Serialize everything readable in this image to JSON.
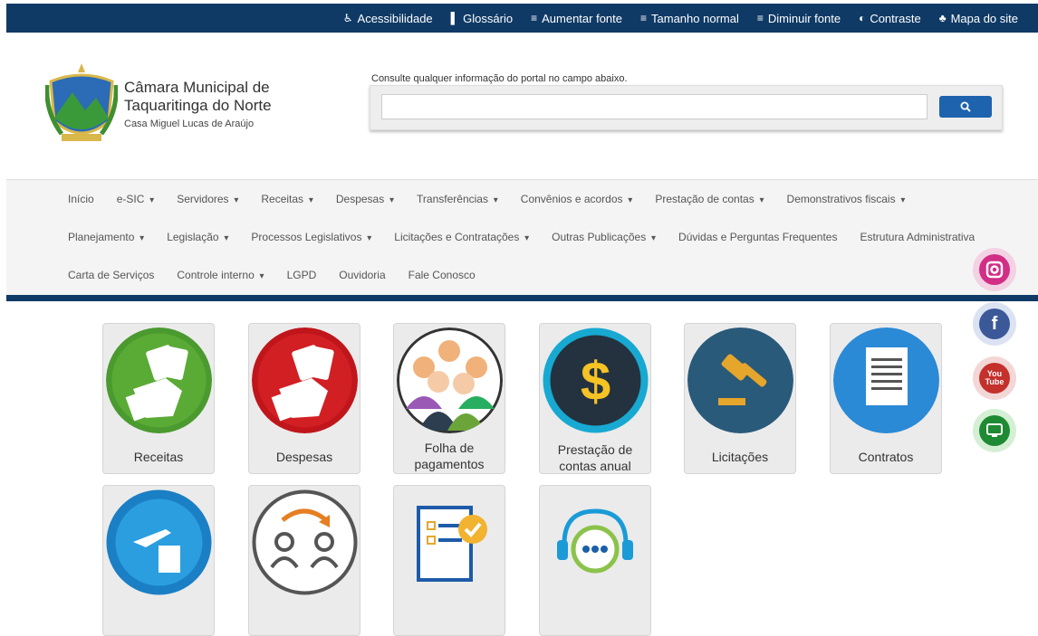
{
  "topbar": {
    "items": [
      {
        "label": "Acessibilidade",
        "icon": "accessibility-icon"
      },
      {
        "label": "Glossário",
        "icon": "book-icon"
      },
      {
        "label": "Aumentar fonte",
        "icon": "font-increase-icon"
      },
      {
        "label": "Tamanho normal",
        "icon": "font-normal-icon"
      },
      {
        "label": "Diminuir fonte",
        "icon": "font-decrease-icon"
      },
      {
        "label": "Contraste",
        "icon": "contrast-icon"
      },
      {
        "label": "Mapa do site",
        "icon": "sitemap-icon"
      }
    ]
  },
  "brand": {
    "line1": "Câmara Municipal de",
    "line2": "Taquaritinga do Norte",
    "line3": "Casa Miguel Lucas de Araújo"
  },
  "search": {
    "hint": "Consulte qualquer informação do portal no campo abaixo.",
    "value": "",
    "placeholder": ""
  },
  "nav": {
    "row1": [
      "Início",
      "e-SIC",
      "Servidores",
      "Receitas",
      "Despesas",
      "Transferências",
      "Convênios e acordos",
      "Prestação de contas",
      "Demonstrativos fiscais"
    ],
    "row2": [
      "Planejamento",
      "Legislação",
      "Processos Legislativos",
      "Licitações e Contratações",
      "Outras Publicações",
      "Dúvidas e Perguntas Frequentes",
      "Estrutura Administrativa"
    ],
    "row3": [
      "Carta de Serviços",
      "Controle interno",
      "LGPD",
      "Ouvidoria",
      "Fale Conosco"
    ]
  },
  "tiles": {
    "receitas": "Receitas",
    "despesas": "Despesas",
    "folha1": "Folha de",
    "folha2": "pagamentos",
    "prestacao1": "Prestação de",
    "prestacao2": "contas anual",
    "licitacoes": "Licitações",
    "contratos": "Contratos"
  },
  "social": {
    "youtube_top": "You",
    "youtube_bottom": "Tube"
  },
  "colors": {
    "topbar": "#0f3a66",
    "accent": "#1e63ad",
    "receitas": "#4a9a2f",
    "despesas": "#c0161b",
    "licitacoes": "#2a5a7a",
    "contratos": "#2a8ad6"
  }
}
